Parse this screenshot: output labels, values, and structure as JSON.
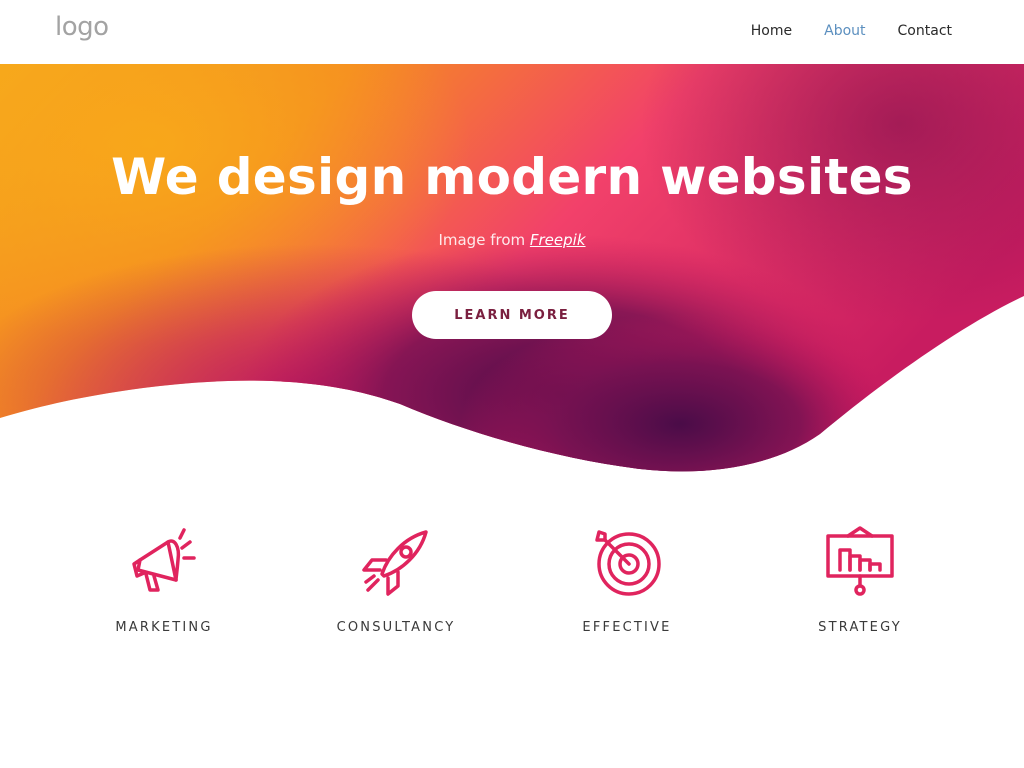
{
  "header": {
    "logo_text": "logo",
    "nav": [
      {
        "label": "Home",
        "active": false
      },
      {
        "label": "About",
        "active": true
      },
      {
        "label": "Contact",
        "active": false
      }
    ]
  },
  "hero": {
    "title": "We design modern websites",
    "credit_prefix": "Image from",
    "credit_link": "Freepik",
    "cta_label": "LEARN MORE"
  },
  "features": [
    {
      "label": "MARKETING",
      "icon": "megaphone-icon"
    },
    {
      "label": "CONSULTANCY",
      "icon": "rocket-icon"
    },
    {
      "label": "EFFECTIVE",
      "icon": "target-icon"
    },
    {
      "label": "STRATEGY",
      "icon": "presentation-chart-icon"
    }
  ],
  "colors": {
    "accent": "#e0245e",
    "nav_active": "#5b8fbf",
    "gradient_orange": "#f7a21b",
    "gradient_pink": "#f23d6e",
    "gradient_plum": "#5a1150"
  }
}
